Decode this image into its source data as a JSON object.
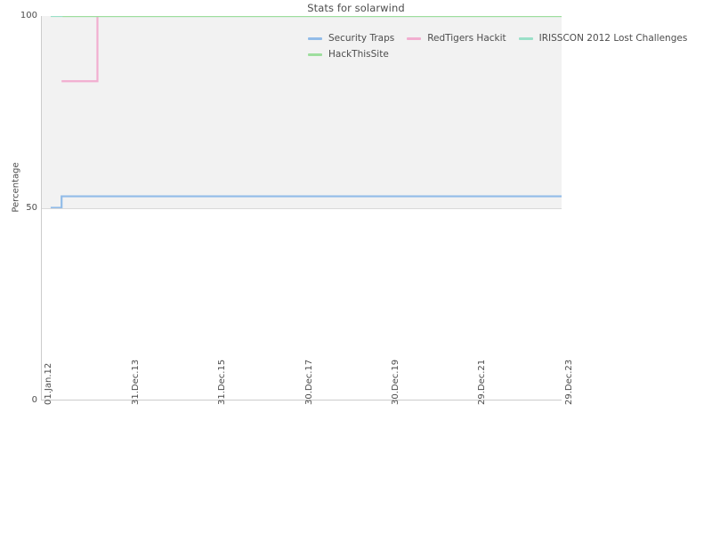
{
  "chart_data": {
    "type": "line",
    "title": "Stats for solarwind",
    "xlabel": "",
    "ylabel": "Percentage",
    "ylim": [
      0,
      100
    ],
    "yticks": [
      "0",
      "50",
      "100"
    ],
    "ytick_values": [
      0,
      50,
      100
    ],
    "grid": true,
    "legend_position": "top-right",
    "x_tick_labels": [
      "01.Jan.12",
      "31.Dec.13",
      "31.Dec.15",
      "30.Dec.17",
      "30.Dec.19",
      "29.Dec.21",
      "29.Dec.23"
    ],
    "x_tick_positions": [
      0.0,
      0.1667,
      0.3333,
      0.5,
      0.6667,
      0.8333,
      1.0
    ],
    "x_range": [
      "01.Jan.12",
      "29.Dec.23"
    ],
    "step_style": "post",
    "series": [
      {
        "name": "Security Traps",
        "color": "#92bce8",
        "x": [
          0.038,
          0.038,
          0.038,
          1.0
        ],
        "values": [
          50,
          50,
          53,
          53
        ],
        "points": [
          {
            "x": 0.017,
            "y": 50
          },
          {
            "x": 0.038,
            "y": 50
          },
          {
            "x": 0.038,
            "y": 53
          },
          {
            "x": 1.0,
            "y": 53
          }
        ]
      },
      {
        "name": "RedTigers Hackit",
        "color": "#f2aed0",
        "points": [
          {
            "x": 0.038,
            "y": 83
          },
          {
            "x": 0.107,
            "y": 83
          },
          {
            "x": 0.107,
            "y": 100
          }
        ]
      },
      {
        "name": "IRISSCON 2012 Lost Challenges",
        "color": "#9ae0c8",
        "points": [
          {
            "x": 0.017,
            "y": 100
          },
          {
            "x": 1.0,
            "y": 100
          }
        ]
      },
      {
        "name": "HackThisSite",
        "color": "#9ede9e",
        "points": [
          {
            "x": 0.04,
            "y": 100
          },
          {
            "x": 1.0,
            "y": 100
          }
        ]
      }
    ]
  },
  "legend": {
    "rows": [
      [
        {
          "label": "Security Traps",
          "color": "#92bce8"
        },
        {
          "label": "RedTigers Hackit",
          "color": "#f2aed0"
        },
        {
          "label": "IRISSCON 2012 Lost Challenges",
          "color": "#9ae0c8"
        }
      ],
      [
        {
          "label": "HackThisSite",
          "color": "#9ede9e"
        }
      ]
    ]
  },
  "colors": {
    "background": "#ffffff",
    "band": "#f2f2f2",
    "axis": "#cccccc",
    "gridline": "#d9d9d9",
    "text": "#4d4d4d"
  }
}
